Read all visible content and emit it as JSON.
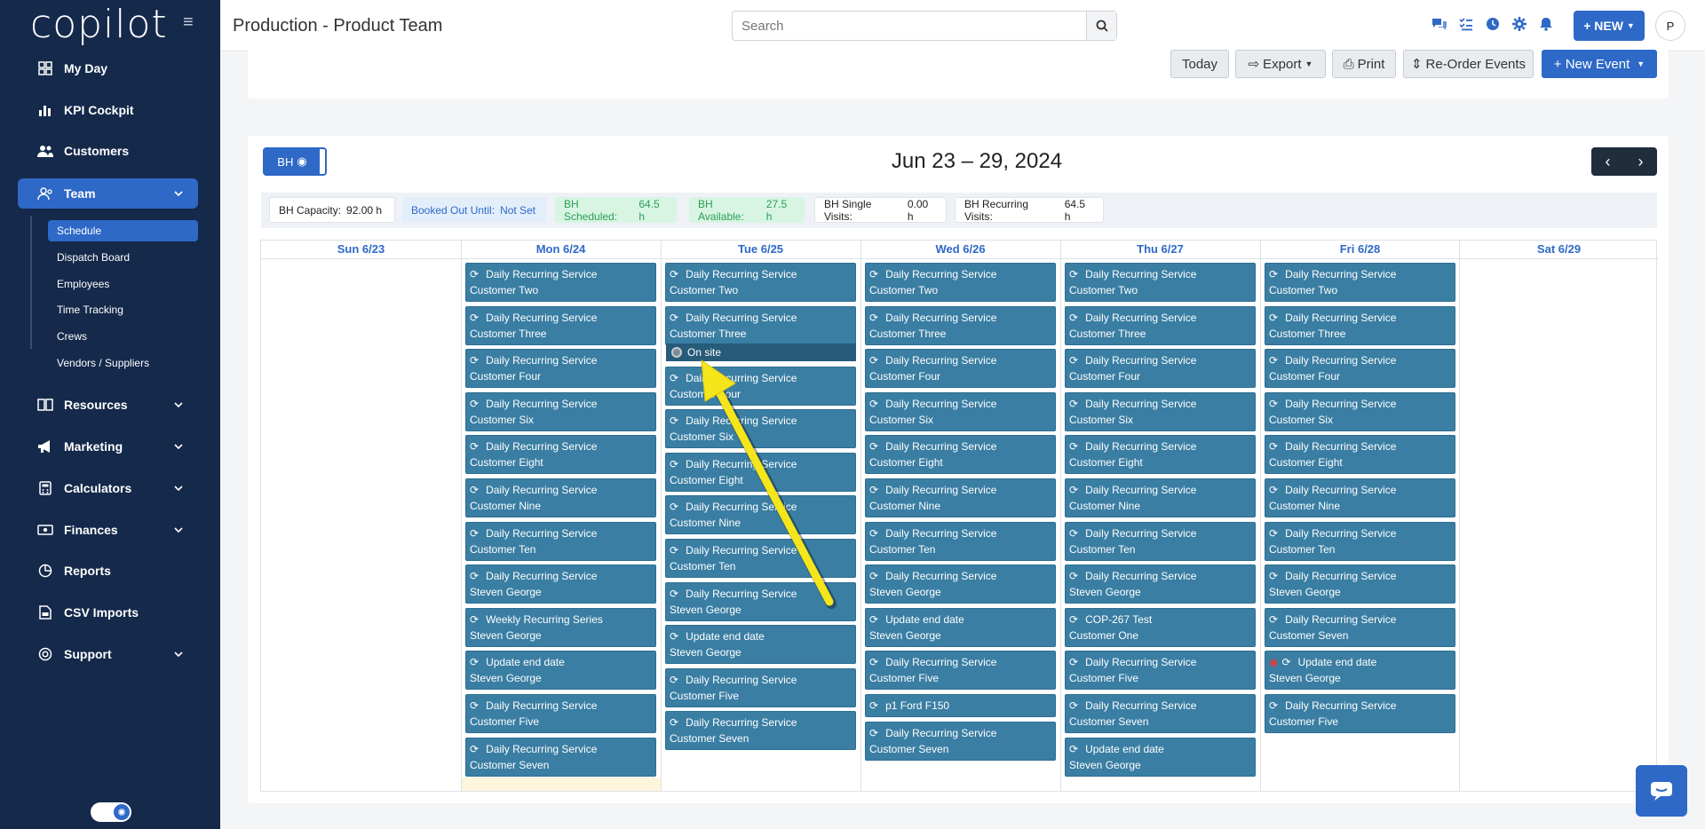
{
  "brand": {
    "logo_text": "copilot"
  },
  "sidebar": {
    "items": [
      {
        "label": "My Day",
        "icon": "grid-icon"
      },
      {
        "label": "KPI Cockpit",
        "icon": "bar-chart-icon"
      },
      {
        "label": "Customers",
        "icon": "users-icon"
      },
      {
        "label": "Team",
        "icon": "team-icon",
        "active": true
      },
      {
        "label": "Resources",
        "icon": "book-icon"
      },
      {
        "label": "Marketing",
        "icon": "megaphone-icon"
      },
      {
        "label": "Calculators",
        "icon": "calculator-icon"
      },
      {
        "label": "Finances",
        "icon": "money-icon"
      },
      {
        "label": "Reports",
        "icon": "pie-chart-icon"
      },
      {
        "label": "CSV Imports",
        "icon": "file-csv-icon"
      },
      {
        "label": "Support",
        "icon": "lifebuoy-icon"
      }
    ],
    "team_sub": [
      "Schedule",
      "Dispatch Board",
      "Employees",
      "Time Tracking",
      "Crews",
      "Vendors / Suppliers"
    ]
  },
  "header": {
    "title": "Production - Product Team",
    "search_placeholder": "Search",
    "new_label": "+ NEW",
    "avatar_initial": "P"
  },
  "toolbar": {
    "today": "Today",
    "export": "Export",
    "print": "Print",
    "reorder": "Re-Order Events",
    "new_event": "+ New Event"
  },
  "calendar": {
    "bh_toggle": "BH",
    "range": "Jun 23 – 29, 2024",
    "stats": [
      {
        "label": "BH Capacity:",
        "value": "92.00 h"
      },
      {
        "label": "Booked Out Until:",
        "value": "Not Set"
      },
      {
        "label": "BH Scheduled:",
        "value": "64.5 h"
      },
      {
        "label": "BH Available:",
        "value": "27.5 h"
      },
      {
        "label": "BH Single Visits:",
        "value": "0.00 h"
      },
      {
        "label": "BH Recurring Visits:",
        "value": "64.5 h"
      }
    ],
    "days": [
      "Sun 6/23",
      "Mon 6/24",
      "Tue 6/25",
      "Wed 6/26",
      "Thu 6/27",
      "Fri 6/28",
      "Sat 6/29"
    ],
    "onsite_label": "On site",
    "events": [
      [],
      [
        [
          "Daily Recurring Service",
          "Customer Two"
        ],
        [
          "Daily Recurring Service",
          "Customer Three"
        ],
        [
          "Daily Recurring Service",
          "Customer Four"
        ],
        [
          "Daily Recurring Service",
          "Customer Six"
        ],
        [
          "Daily Recurring Service",
          "Customer Eight"
        ],
        [
          "Daily Recurring Service",
          "Customer Nine"
        ],
        [
          "Daily Recurring Service",
          "Customer Ten"
        ],
        [
          "Daily Recurring Service",
          "Steven George"
        ],
        [
          "Weekly Recurring Series",
          "Steven George"
        ],
        [
          "Update end date",
          "Steven George"
        ],
        [
          "Daily Recurring Service",
          "Customer Five"
        ],
        [
          "Daily Recurring Service",
          "Customer Seven"
        ]
      ],
      [
        [
          "Daily Recurring Service",
          "Customer Two"
        ],
        [
          "Daily Recurring Service",
          "Customer Three"
        ],
        [
          "Daily Recurring Service",
          "Customer Four"
        ],
        [
          "Daily Recurring Service",
          "Customer Six"
        ],
        [
          "Daily Recurring Service",
          "Customer Eight"
        ],
        [
          "Daily Recurring Service",
          "Customer Nine"
        ],
        [
          "Daily Recurring Service",
          "Customer Ten"
        ],
        [
          "Daily Recurring Service",
          "Steven George"
        ],
        [
          "Update end date",
          "Steven George"
        ],
        [
          "Daily Recurring Service",
          "Customer Five"
        ],
        [
          "Daily Recurring Service",
          "Customer Seven"
        ]
      ],
      [
        [
          "Daily Recurring Service",
          "Customer Two"
        ],
        [
          "Daily Recurring Service",
          "Customer Three"
        ],
        [
          "Daily Recurring Service",
          "Customer Four"
        ],
        [
          "Daily Recurring Service",
          "Customer Six"
        ],
        [
          "Daily Recurring Service",
          "Customer Eight"
        ],
        [
          "Daily Recurring Service",
          "Customer Nine"
        ],
        [
          "Daily Recurring Service",
          "Customer Ten"
        ],
        [
          "Daily Recurring Service",
          "Steven George"
        ],
        [
          "Update end date",
          "Steven George"
        ],
        [
          "Daily Recurring Service",
          "Customer Five"
        ],
        [
          "p1 Ford F150",
          ""
        ],
        [
          "Daily Recurring Service",
          "Customer Seven"
        ]
      ],
      [
        [
          "Daily Recurring Service",
          "Customer Two"
        ],
        [
          "Daily Recurring Service",
          "Customer Three"
        ],
        [
          "Daily Recurring Service",
          "Customer Four"
        ],
        [
          "Daily Recurring Service",
          "Customer Six"
        ],
        [
          "Daily Recurring Service",
          "Customer Eight"
        ],
        [
          "Daily Recurring Service",
          "Customer Nine"
        ],
        [
          "Daily Recurring Service",
          "Customer Ten"
        ],
        [
          "Daily Recurring Service",
          "Steven George"
        ],
        [
          "COP-267 Test",
          "Customer One"
        ],
        [
          "Daily Recurring Service",
          "Customer Five"
        ],
        [
          "Daily Recurring Service",
          "Customer Seven"
        ],
        [
          "Update end date",
          "Steven George"
        ]
      ],
      [
        [
          "Daily Recurring Service",
          "Customer Two"
        ],
        [
          "Daily Recurring Service",
          "Customer Three"
        ],
        [
          "Daily Recurring Service",
          "Customer Four"
        ],
        [
          "Daily Recurring Service",
          "Customer Six"
        ],
        [
          "Daily Recurring Service",
          "Customer Eight"
        ],
        [
          "Daily Recurring Service",
          "Customer Nine"
        ],
        [
          "Daily Recurring Service",
          "Customer Ten"
        ],
        [
          "Daily Recurring Service",
          "Steven George"
        ],
        [
          "Daily Recurring Service",
          "Customer Seven"
        ],
        [
          "Update end date",
          "Steven George"
        ],
        [
          "Daily Recurring Service",
          "Customer Five"
        ]
      ],
      []
    ]
  },
  "colors": {
    "accent": "#2e69c7",
    "sidebar_bg": "#15294b",
    "event_bg": "#3a7ea3",
    "arrow": "#f5e51b"
  }
}
